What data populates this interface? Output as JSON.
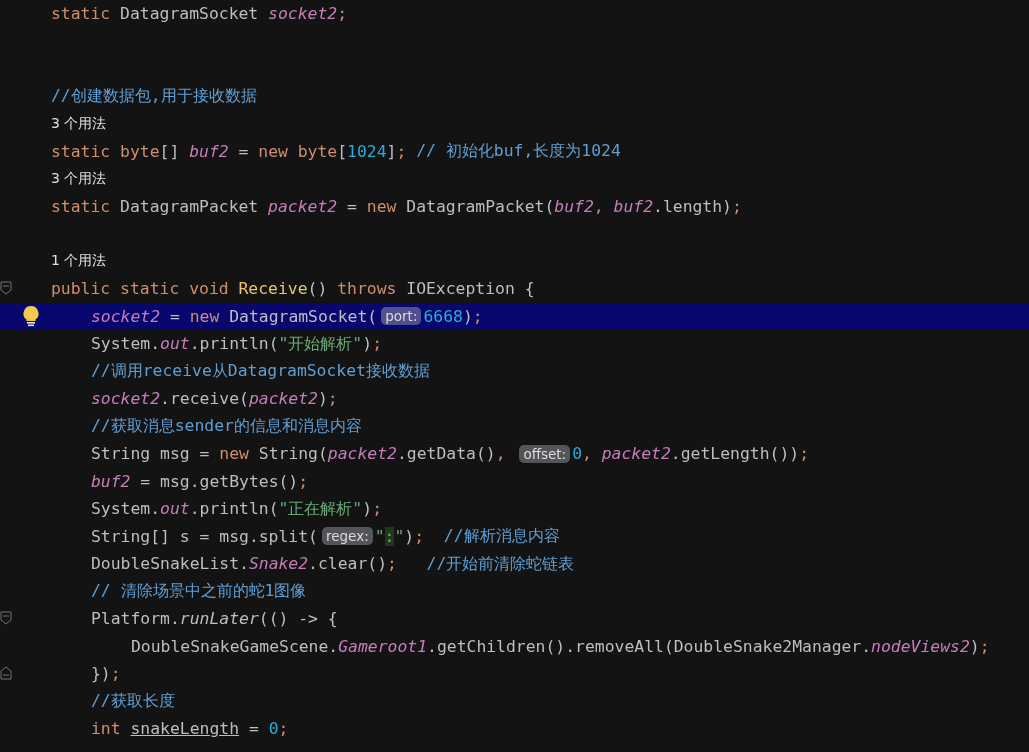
{
  "editor": {
    "lines": [
      {
        "kind": "code",
        "selected": false,
        "tokens": [
          {
            "text": "static ",
            "kind": "kw"
          },
          {
            "text": "DatagramSocket ",
            "kind": "plain"
          },
          {
            "text": "socket2",
            "kind": "field"
          },
          {
            "text": ";",
            "kind": "kw"
          }
        ]
      },
      {
        "kind": "blank"
      },
      {
        "kind": "blank"
      },
      {
        "kind": "code",
        "selected": false,
        "tokens": [
          {
            "text": "//创建数据包,用于接收数据",
            "kind": "comment"
          }
        ]
      },
      {
        "kind": "usage",
        "text": "3 个用法"
      },
      {
        "kind": "code",
        "selected": false,
        "tokens": [
          {
            "text": "static ",
            "kind": "kw"
          },
          {
            "text": "byte",
            "kind": "kw"
          },
          {
            "text": "[] ",
            "kind": "plain"
          },
          {
            "text": "buf2",
            "kind": "field"
          },
          {
            "text": " = ",
            "kind": "plain"
          },
          {
            "text": "new ",
            "kind": "kw"
          },
          {
            "text": "byte",
            "kind": "kw"
          },
          {
            "text": "[",
            "kind": "plain"
          },
          {
            "text": "1024",
            "kind": "num"
          },
          {
            "text": "]",
            "kind": "plain"
          },
          {
            "text": ";",
            "kind": "kw"
          },
          {
            "text": " // 初始化buf,长度为1024",
            "kind": "comment"
          }
        ]
      },
      {
        "kind": "usage",
        "text": "3 个用法"
      },
      {
        "kind": "code",
        "selected": false,
        "tokens": [
          {
            "text": "static ",
            "kind": "kw"
          },
          {
            "text": "DatagramPacket ",
            "kind": "plain"
          },
          {
            "text": "packet2",
            "kind": "field"
          },
          {
            "text": " = ",
            "kind": "plain"
          },
          {
            "text": "new ",
            "kind": "kw"
          },
          {
            "text": "DatagramPacket(",
            "kind": "plain"
          },
          {
            "text": "buf2",
            "kind": "field"
          },
          {
            "text": ", ",
            "kind": "kw"
          },
          {
            "text": "buf2",
            "kind": "field"
          },
          {
            "text": ".length)",
            "kind": "plain"
          },
          {
            "text": ";",
            "kind": "kw"
          }
        ]
      },
      {
        "kind": "blank"
      },
      {
        "kind": "usage",
        "text": "1 个用法"
      },
      {
        "kind": "code",
        "selected": false,
        "marker": {
          "kind": "fold-start"
        },
        "tokens": [
          {
            "text": "public static void ",
            "kind": "kw"
          },
          {
            "text": "Receive",
            "kind": "fn"
          },
          {
            "text": "() ",
            "kind": "plain"
          },
          {
            "text": "throws ",
            "kind": "kw"
          },
          {
            "text": "IOException {",
            "kind": "plain"
          }
        ],
        "children": [
          {
            "kind": "code",
            "selected": true,
            "tokens": [
              {
                "text": "socket2",
                "kind": "field"
              },
              {
                "text": " = ",
                "kind": "plain"
              },
              {
                "text": "new ",
                "kind": "kw"
              },
              {
                "text": "DatagramSocket(",
                "kind": "plain"
              },
              {
                "text": "port:",
                "kind": "hint"
              },
              {
                "text": "6668",
                "kind": "num"
              },
              {
                "text": ")",
                "kind": "plain"
              },
              {
                "text": ";",
                "kind": "kw"
              }
            ]
          },
          {
            "kind": "code",
            "selected": false,
            "tokens": [
              {
                "text": "System.",
                "kind": "plain"
              },
              {
                "text": "out",
                "kind": "field"
              },
              {
                "text": ".println(",
                "kind": "plain"
              },
              {
                "text": "\"开始解析\"",
                "kind": "str"
              },
              {
                "text": ")",
                "kind": "plain"
              },
              {
                "text": ";",
                "kind": "kw"
              }
            ]
          },
          {
            "kind": "code",
            "selected": false,
            "tokens": [
              {
                "text": "//调用receive从DatagramSocket接收数据",
                "kind": "comment"
              }
            ]
          },
          {
            "kind": "code",
            "selected": false,
            "tokens": [
              {
                "text": "socket2",
                "kind": "field"
              },
              {
                "text": ".receive(",
                "kind": "plain"
              },
              {
                "text": "packet2",
                "kind": "field"
              },
              {
                "text": ")",
                "kind": "plain"
              },
              {
                "text": ";",
                "kind": "kw"
              }
            ]
          },
          {
            "kind": "code",
            "selected": false,
            "tokens": [
              {
                "text": "//获取消息sender的信息和消息内容",
                "kind": "comment"
              }
            ]
          },
          {
            "kind": "code",
            "selected": false,
            "tokens": [
              {
                "text": "String msg = ",
                "kind": "plain"
              },
              {
                "text": "new ",
                "kind": "kw"
              },
              {
                "text": "String(",
                "kind": "plain"
              },
              {
                "text": "packet2",
                "kind": "field"
              },
              {
                "text": ".getData()",
                "kind": "plain"
              },
              {
                "text": ", ",
                "kind": "kw"
              },
              {
                "text": "offset:",
                "kind": "hint"
              },
              {
                "text": "0",
                "kind": "num"
              },
              {
                "text": ", ",
                "kind": "kw"
              },
              {
                "text": "packet2",
                "kind": "field"
              },
              {
                "text": ".getLength())",
                "kind": "plain"
              },
              {
                "text": ";",
                "kind": "kw"
              }
            ]
          },
          {
            "kind": "code",
            "selected": false,
            "tokens": [
              {
                "text": "buf2",
                "kind": "field"
              },
              {
                "text": " = msg.getBytes()",
                "kind": "plain"
              },
              {
                "text": ";",
                "kind": "kw"
              }
            ]
          },
          {
            "kind": "code",
            "selected": false,
            "tokens": [
              {
                "text": "System.",
                "kind": "plain"
              },
              {
                "text": "out",
                "kind": "field"
              },
              {
                "text": ".println(",
                "kind": "plain"
              },
              {
                "text": "\"正在解析\"",
                "kind": "str"
              },
              {
                "text": ")",
                "kind": "plain"
              },
              {
                "text": ";",
                "kind": "kw"
              }
            ]
          },
          {
            "kind": "code",
            "selected": false,
            "tokens": [
              {
                "text": "String[] s = msg.split(",
                "kind": "plain"
              },
              {
                "text": "regex:",
                "kind": "hint"
              },
              {
                "text": "\"",
                "kind": "str"
              },
              {
                "text": ":",
                "kind": "strmark"
              },
              {
                "text": "\"",
                "kind": "str"
              },
              {
                "text": ")",
                "kind": "plain"
              },
              {
                "text": ";",
                "kind": "kw"
              },
              {
                "text": "  //解析消息内容",
                "kind": "comment"
              }
            ]
          },
          {
            "kind": "code",
            "selected": false,
            "tokens": [
              {
                "text": "DoubleSnakeList.",
                "kind": "plain"
              },
              {
                "text": "Snake2",
                "kind": "field"
              },
              {
                "text": ".clear()",
                "kind": "plain"
              },
              {
                "text": ";",
                "kind": "kw"
              },
              {
                "text": "   //开始前清除蛇链表",
                "kind": "comment"
              }
            ]
          },
          {
            "kind": "code",
            "selected": false,
            "tokens": [
              {
                "text": "// 清除场景中之前的蛇1图像",
                "kind": "comment"
              }
            ]
          },
          {
            "kind": "code",
            "selected": false,
            "marker": {
              "kind": "fold-start"
            },
            "tokens": [
              {
                "text": "Platform.",
                "kind": "plain"
              },
              {
                "text": "runLater",
                "kind": "static"
              },
              {
                "text": "(() -> {",
                "kind": "plain"
              }
            ],
            "children": [
              {
                "kind": "code",
                "selected": false,
                "tokens": [
                  {
                    "text": "DoubleSnakeGameScene.",
                    "kind": "plain"
                  },
                  {
                    "text": "Gameroot1",
                    "kind": "field"
                  },
                  {
                    "text": ".getChildren().removeAll(DoubleSnake2Manager.",
                    "kind": "plain"
                  },
                  {
                    "text": "nodeViews2",
                    "kind": "field"
                  },
                  {
                    "text": ")",
                    "kind": "plain"
                  },
                  {
                    "text": ";",
                    "kind": "kw"
                  }
                ]
              }
            ]
          },
          {
            "kind": "code",
            "selected": false,
            "marker": {
              "kind": "fold-end"
            },
            "tokens": [
              {
                "text": "})",
                "kind": "plain"
              },
              {
                "text": ";",
                "kind": "kw"
              }
            ]
          },
          {
            "kind": "code",
            "selected": false,
            "tokens": [
              {
                "text": "//获取长度",
                "kind": "comment"
              }
            ]
          },
          {
            "kind": "code",
            "selected": false,
            "tokens": [
              {
                "text": "int ",
                "kind": "kw"
              },
              {
                "text": "snakeLength",
                "kind": "local"
              },
              {
                "text": " = ",
                "kind": "plain"
              },
              {
                "text": "0",
                "kind": "num"
              },
              {
                "text": ";",
                "kind": "kw"
              }
            ]
          }
        ]
      }
    ]
  }
}
